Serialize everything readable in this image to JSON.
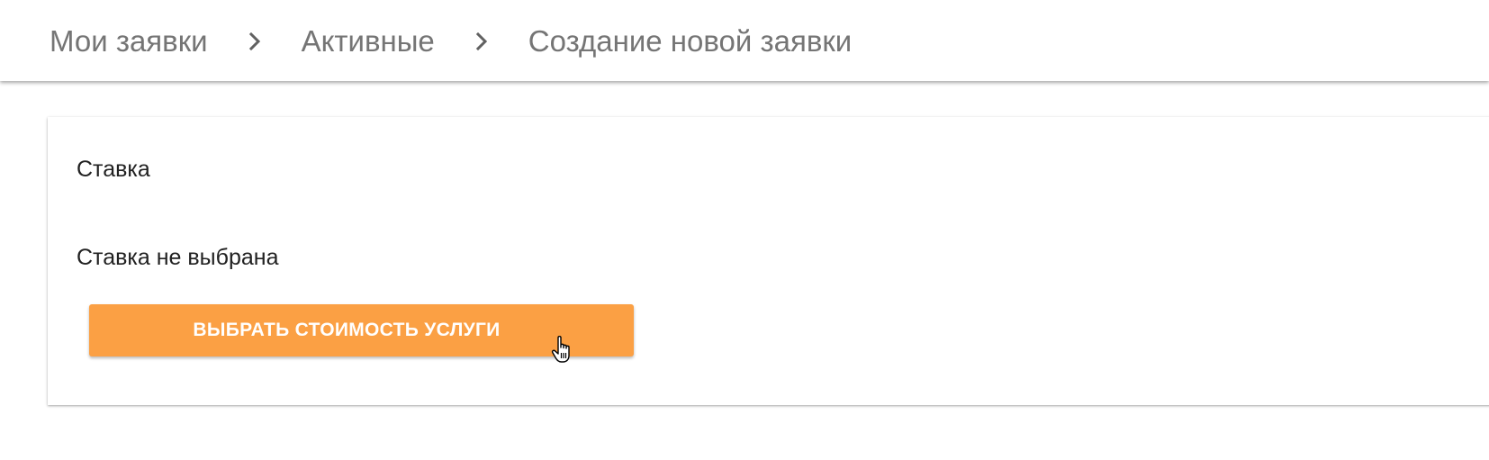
{
  "breadcrumb": {
    "items": [
      {
        "label": "Мои заявки"
      },
      {
        "label": "Активные"
      },
      {
        "label": "Создание новой заявки"
      }
    ]
  },
  "rate_card": {
    "title": "Ставка",
    "status": "Ставка не выбрана",
    "select_button_label": "ВЫБРАТЬ СТОИМОСТЬ УСЛУГИ"
  },
  "colors": {
    "accent": "#fba044",
    "breadcrumb_text": "#757575",
    "body_text": "#212121"
  },
  "icons": {
    "separator": "chevron-right-icon",
    "pointer": "hand-cursor-icon"
  }
}
